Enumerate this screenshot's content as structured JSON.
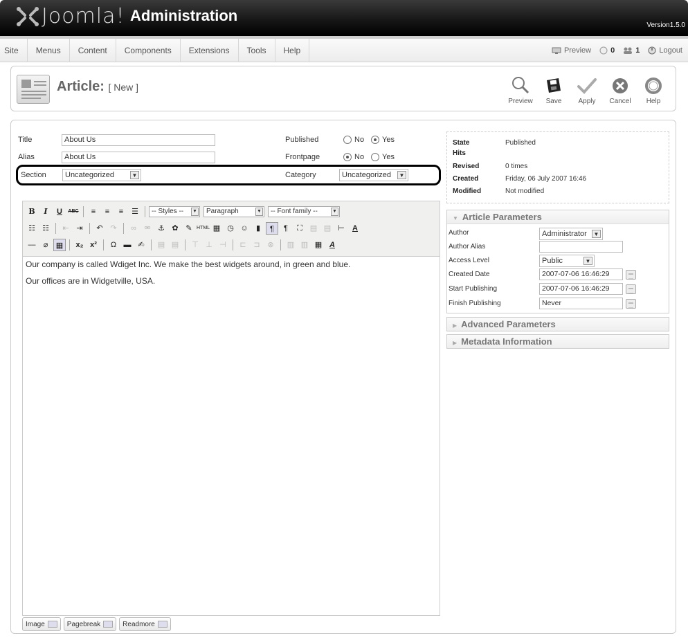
{
  "header": {
    "logo_text": "Joomla!",
    "title": "Administration",
    "version": "Version1.5.0"
  },
  "menu": [
    "Site",
    "Menus",
    "Content",
    "Components",
    "Extensions",
    "Tools",
    "Help"
  ],
  "status": {
    "preview": "Preview",
    "messages": "0",
    "users": "1",
    "logout": "Logout"
  },
  "toolbar": {
    "page_title": "Article:",
    "page_subtitle": "[ New ]",
    "actions": {
      "preview": "Preview",
      "save": "Save",
      "apply": "Apply",
      "cancel": "Cancel",
      "help": "Help"
    }
  },
  "form": {
    "title_label": "Title",
    "title_value": "About Us",
    "alias_label": "Alias",
    "alias_value": "About Us",
    "section_label": "Section",
    "section_value": "Uncategorized",
    "published_label": "Published",
    "frontpage_label": "Frontpage",
    "category_label": "Category",
    "category_value": "Uncategorized",
    "no_label": "No",
    "yes_label": "Yes"
  },
  "editor": {
    "styles": "-- Styles --",
    "paragraph": "Paragraph",
    "font_family": "-- Font family --",
    "paragraphs": [
      "Our company is called Wdiget Inc. We make the best widgets around, in green and blue.",
      "Our offices are in Widgetville, USA."
    ],
    "buttons": {
      "image": "Image",
      "pagebreak": "Pagebreak",
      "readmore": "Readmore"
    }
  },
  "info": {
    "state_label": "State",
    "state_value": "Published",
    "hits_label": "Hits",
    "revised_label": "Revised",
    "revised_value": "0 times",
    "created_label": "Created",
    "created_value": "Friday, 06 July 2007 16:46",
    "modified_label": "Modified",
    "modified_value": "Not modified"
  },
  "params": {
    "heading": "Article Parameters",
    "author_label": "Author",
    "author_value": "Administrator",
    "author_alias_label": "Author Alias",
    "author_alias_value": "",
    "access_label": "Access Level",
    "access_value": "Public",
    "created_date_label": "Created Date",
    "created_date_value": "2007-07-06 16:46:29",
    "start_label": "Start Publishing",
    "start_value": "2007-07-06 16:46:29",
    "finish_label": "Finish Publishing",
    "finish_value": "Never"
  },
  "panels": {
    "advanced": "Advanced Parameters",
    "metadata": "Metadata Information"
  }
}
